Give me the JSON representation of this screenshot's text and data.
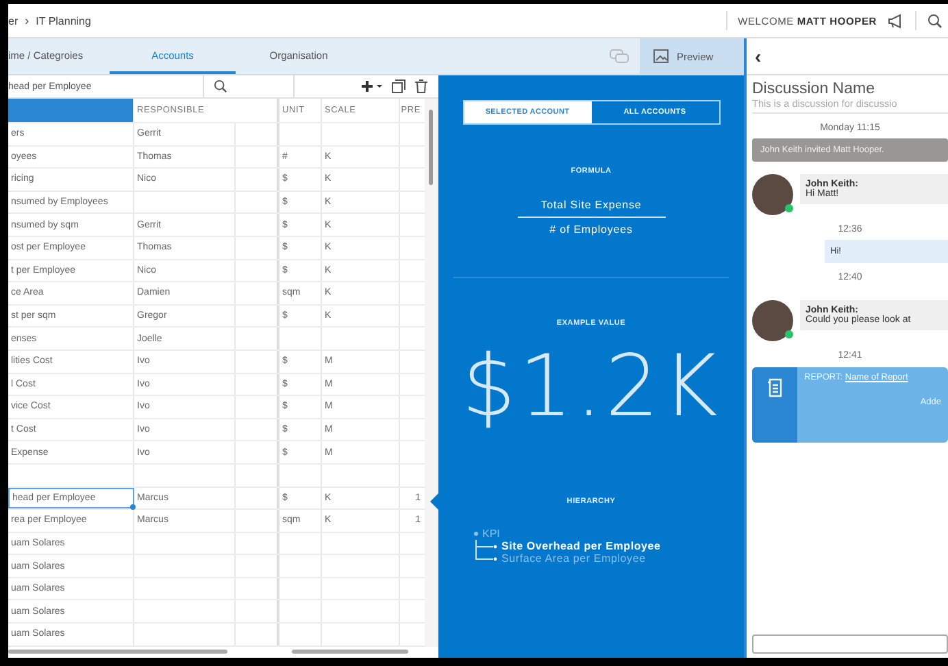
{
  "breadcrumb": {
    "parent": "er",
    "separator": "›",
    "current": "IT Planning"
  },
  "header": {
    "welcome": "WELCOME",
    "user": "MATT HOOPER"
  },
  "tabs": [
    {
      "label": "ime / Categroies",
      "selected": false
    },
    {
      "label": "Accounts",
      "selected": true
    },
    {
      "label": "Organisation",
      "selected": false
    }
  ],
  "preview_button": {
    "label": "Preview"
  },
  "search": {
    "value": "head per Employee"
  },
  "table": {
    "columns": {
      "responsible": "RESPONSIBLE",
      "unit": "UNIT",
      "scale": "SCALE",
      "pre": "PRE"
    },
    "rows": [
      {
        "name": "ers",
        "responsible": "Gerrit",
        "selected": false
      },
      {
        "name": "oyees",
        "responsible": "Thomas",
        "unit": "#",
        "scale": "K",
        "selected": false
      },
      {
        "name": "ricing",
        "responsible": "Nico",
        "unit": "$",
        "scale": "K",
        "selected": false
      },
      {
        "name": "nsumed by Employees",
        "unit": "$",
        "scale": "K",
        "selected": false
      },
      {
        "name": "nsumed by sqm",
        "responsible": "Gerrit",
        "unit": "$",
        "scale": "K",
        "selected": false
      },
      {
        "name": "ost per Employee",
        "responsible": "Thomas",
        "unit": "$",
        "scale": "K",
        "selected": false
      },
      {
        "name": "t per Employee",
        "responsible": "Nico",
        "unit": "$",
        "scale": "K",
        "selected": false
      },
      {
        "name": "ce Area",
        "responsible": "Damien",
        "unit": "sqm",
        "scale": "K",
        "selected": false
      },
      {
        "name": "st per sqm",
        "responsible": "Gregor",
        "unit": "$",
        "scale": "K",
        "selected": false
      },
      {
        "name": "enses",
        "responsible": "Joelle",
        "selected": false
      },
      {
        "name": "lities Cost",
        "responsible": "Ivo",
        "unit": "$",
        "scale": "M",
        "selected": false
      },
      {
        "name": "l Cost",
        "responsible": "Ivo",
        "unit": "$",
        "scale": "M",
        "selected": false
      },
      {
        "name": "vice Cost",
        "responsible": "Ivo",
        "unit": "$",
        "scale": "M",
        "selected": false
      },
      {
        "name": "t Cost",
        "responsible": "Ivo",
        "unit": "$",
        "scale": "M",
        "selected": false
      },
      {
        "name": "Expense",
        "responsible": "Ivo",
        "unit": "$",
        "scale": "M",
        "selected": false
      },
      {
        "selected": false
      },
      {
        "name": "head per Employee",
        "responsible": "Marcus",
        "unit": "$",
        "scale": "K",
        "pre": "1",
        "selected": true
      },
      {
        "name": "rea per Employee",
        "responsible": "Marcus",
        "unit": "sqm",
        "scale": "K",
        "pre": "1",
        "selected": false
      },
      {
        "name": "uam Solares",
        "selected": false
      },
      {
        "name": "uam Solares",
        "selected": false
      },
      {
        "name": "uam Solares",
        "selected": false
      },
      {
        "name": "uam Solares",
        "selected": false
      },
      {
        "name": "uam Solares",
        "selected": false
      }
    ]
  },
  "view_toggle": [
    {
      "label": "SELECTED ACCOUNT",
      "selected": true
    },
    {
      "label": "ALL ACCOUNTS",
      "selected": false
    }
  ],
  "formula": {
    "title": "FORMULA",
    "numerator": "Total Site Expense",
    "denominator": "# of Employees"
  },
  "example": {
    "title": "EXAMPLE VALUE",
    "value": "$1.2K"
  },
  "hierarchy": {
    "title": "HIERARCHY",
    "tree": [
      {
        "label": "KPI",
        "children": [
          {
            "label": "Site Overhead per Employee",
            "selected": true
          },
          {
            "label": "Surface Area per Employee",
            "selected": false
          }
        ]
      }
    ]
  },
  "discussion": {
    "back": "‹",
    "title": "Discussion Name",
    "description": "This is a discussion for discussio",
    "messages": [
      {
        "kind": "time",
        "text": "Monday 11:15"
      },
      {
        "kind": "system",
        "text": "John Keith invited Matt Hooper."
      },
      {
        "kind": "incoming",
        "author": "John Keith:",
        "text": "Hi Matt!",
        "online": true
      },
      {
        "kind": "time",
        "text": "12:36"
      },
      {
        "kind": "outgoing",
        "text": "Hi!"
      },
      {
        "kind": "time",
        "text": "12:40"
      },
      {
        "kind": "incoming",
        "author": "John Keith:",
        "text": "Could you please look at",
        "online": true
      },
      {
        "kind": "time",
        "text": "12:41"
      },
      {
        "kind": "report",
        "label": "REPORT:",
        "link": "Name of Report",
        "note": "Adde"
      }
    ]
  }
}
